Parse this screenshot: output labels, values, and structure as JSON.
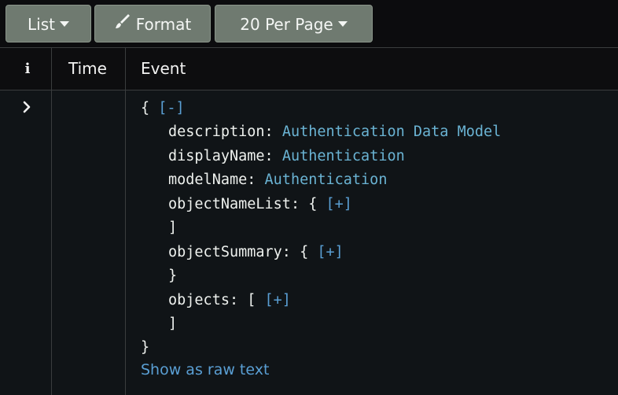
{
  "toolbar": {
    "list_label": "List",
    "format_label": "Format",
    "per_page_label": "20 Per Page"
  },
  "table": {
    "columns": {
      "info_icon": "info-icon",
      "time": "Time",
      "event": "Event"
    }
  },
  "event": {
    "open_brace": "{",
    "collapse_toggle": "[-]",
    "fields": [
      {
        "key": "description",
        "value": "Authentication Data Model"
      },
      {
        "key": "displayName",
        "value": "Authentication"
      },
      {
        "key": "modelName",
        "value": "Authentication"
      }
    ],
    "nested": [
      {
        "key": "objectNameList",
        "open": "{",
        "toggle": "[+]",
        "close": "]"
      },
      {
        "key": "objectSummary",
        "open": "{",
        "toggle": "[+]",
        "close": "}"
      },
      {
        "key": "objects",
        "open": "[",
        "toggle": "[+]",
        "close": "]"
      }
    ],
    "close_brace": "}",
    "raw_text_link": "Show as raw text"
  },
  "colors": {
    "background": "#0c0c0e",
    "button_bg": "#6f7a70",
    "value_text": "#6ab3d3",
    "link": "#5a9fd4"
  }
}
